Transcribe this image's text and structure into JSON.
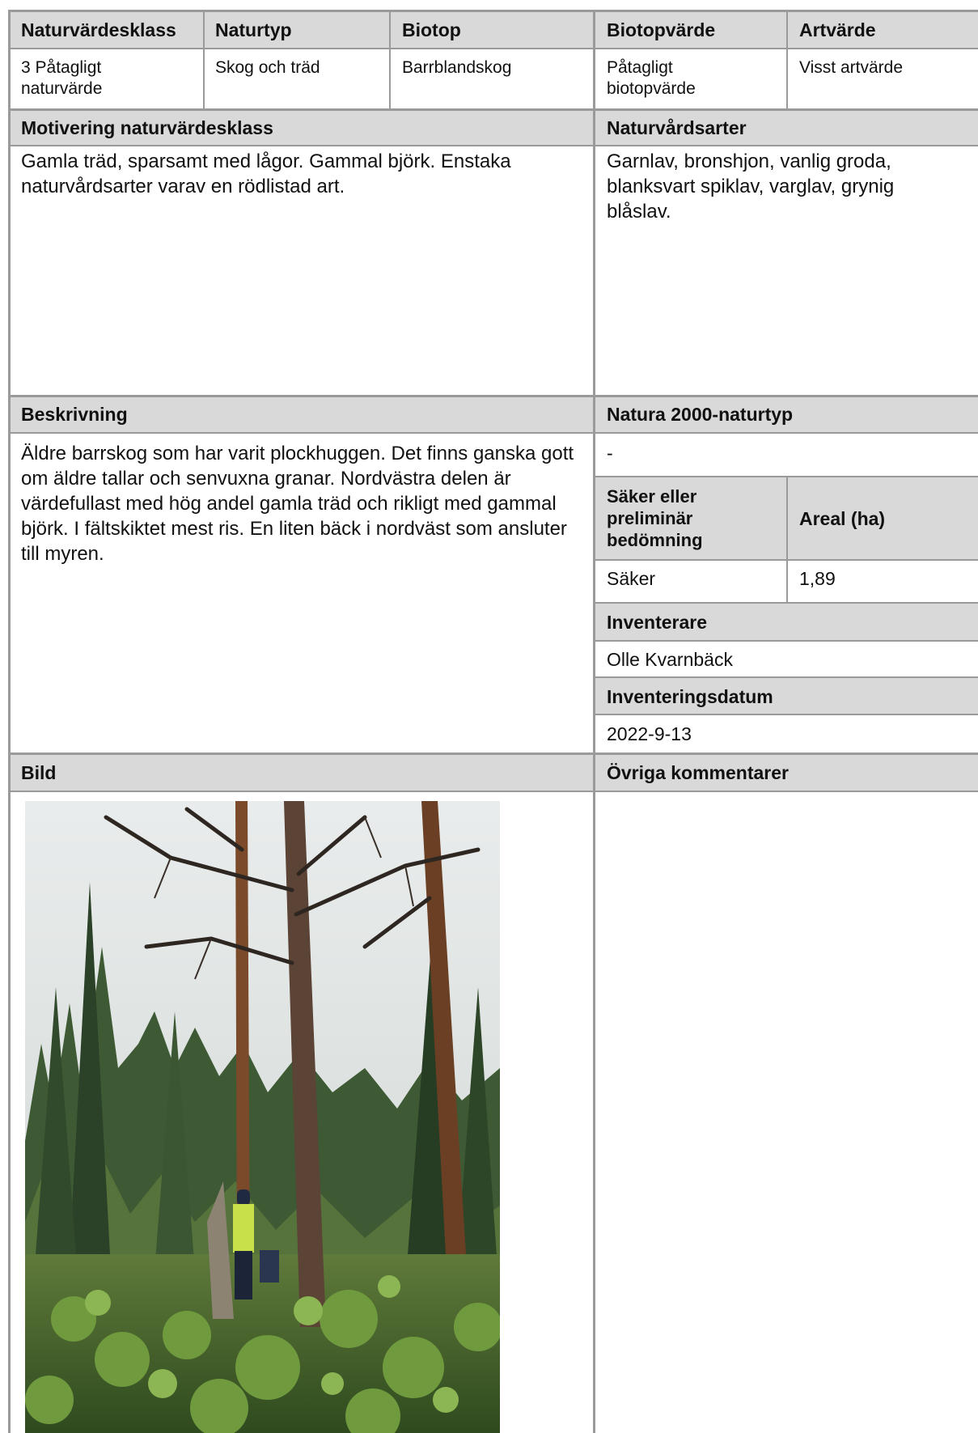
{
  "top_headers": [
    "Naturvärdesklass",
    "Naturtyp",
    "Biotop",
    "Biotopvärde",
    "Artvärde"
  ],
  "top_values": [
    "3 Påtagligt\nnaturvärde",
    "Skog och träd",
    "Barrblandskog",
    "Påtagligt\nbiotopvärde",
    "Visst artvärde"
  ],
  "motivering": {
    "label": "Motivering naturvärdesklass",
    "text": "Gamla träd, sparsamt med lågor. Gammal björk. Enstaka naturvårdsarter varav en rödlistad art."
  },
  "naturvardsarter": {
    "label": "Naturvårdsarter",
    "text": "Garnlav, bronshjon, vanlig groda, blanksvart spiklav, varglav, grynig blåslav."
  },
  "beskrivning": {
    "label": "Beskrivning",
    "text": "Äldre barrskog som har varit plockhuggen. Det finns ganska gott om äldre tallar och senvuxna granar. Nordvästra delen  är värdefullast med hög andel gamla träd och rikligt med gammal björk. I fältskiktet mest ris. En liten bäck i nordväst som ansluter till myren."
  },
  "natura2000": {
    "label": "Natura 2000-naturtyp",
    "value": "-",
    "col1_header": "Säker eller preliminär bedömning",
    "col2_header": "Areal (ha)",
    "col1_value": "Säker",
    "col2_value": "1,89"
  },
  "inventerare": {
    "label": "Inventerare",
    "value": "Olle Kvarnbäck"
  },
  "inventeringsdatum": {
    "label": "Inventeringsdatum",
    "value": "2022-9-13"
  },
  "bild": {
    "label": "Bild"
  },
  "ovriga": {
    "label": "Övriga kommentarer"
  }
}
